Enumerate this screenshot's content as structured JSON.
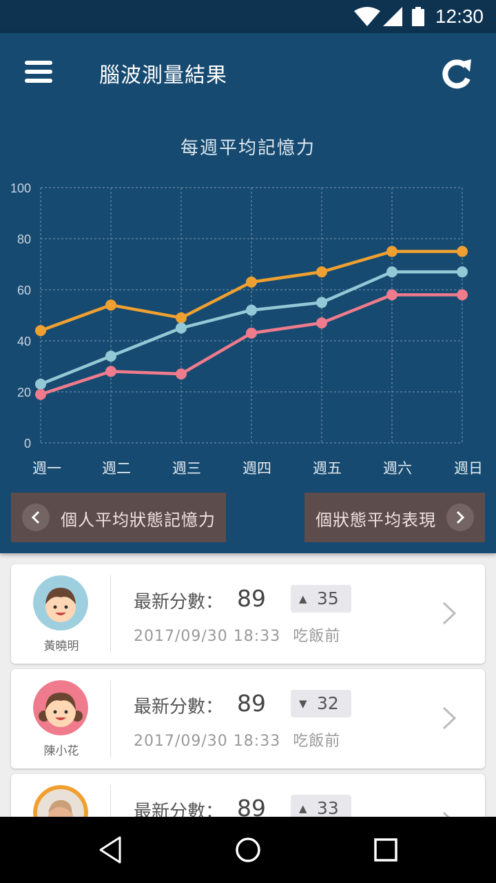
{
  "status_bar": {
    "time": "12:30",
    "icons": [
      "wifi-icon",
      "signal-icon",
      "battery-icon"
    ]
  },
  "app_bar": {
    "title": "腦波測量結果",
    "menu_icon": "hamburger-menu-icon",
    "refresh_icon": "refresh-icon"
  },
  "chart_data": {
    "type": "line",
    "title": "每週平均記憶力",
    "categories": [
      "週一",
      "週二",
      "週三",
      "週四",
      "週五",
      "週六",
      "週日"
    ],
    "ylim": [
      0,
      100
    ],
    "yticks": [
      0,
      20,
      40,
      60,
      80,
      100
    ],
    "grid": true,
    "legend": "none",
    "series": [
      {
        "color": "#f0a030",
        "values": [
          44,
          54,
          49,
          63,
          67,
          75,
          75
        ]
      },
      {
        "color": "#93c9d6",
        "values": [
          23,
          34,
          45,
          52,
          55,
          67,
          67
        ]
      },
      {
        "color": "#ef7b8c",
        "values": [
          19,
          28,
          27,
          43,
          47,
          58,
          58
        ]
      }
    ]
  },
  "nav_buttons": {
    "prev_label": "個人平均狀態記憶力",
    "next_label": "個狀態平均表現"
  },
  "cards": [
    {
      "name": "黃曉明",
      "score_label": "最新分數：",
      "score": "89",
      "trend": "up",
      "trend_symbol": "▲",
      "delta": "35",
      "timestamp": "2017/09/30 18:33",
      "status": "吃飯前",
      "avatar_color": "#9ecfde"
    },
    {
      "name": "陳小花",
      "score_label": "最新分數：",
      "score": "89",
      "trend": "down",
      "trend_symbol": "▼",
      "delta": "32",
      "timestamp": "2017/09/30 18:33",
      "status": "吃飯前",
      "avatar_color": "#ef7b8c"
    },
    {
      "name": "",
      "score_label": "最新分數：",
      "score": "89",
      "trend": "up",
      "trend_symbol": "▲",
      "delta": "33",
      "timestamp": "",
      "status": "",
      "avatar_color": "#f0a030"
    }
  ],
  "colors": {
    "header_bg": "#164a70",
    "status_bg": "#0d3350",
    "button_bg": "#5d4c4c"
  }
}
